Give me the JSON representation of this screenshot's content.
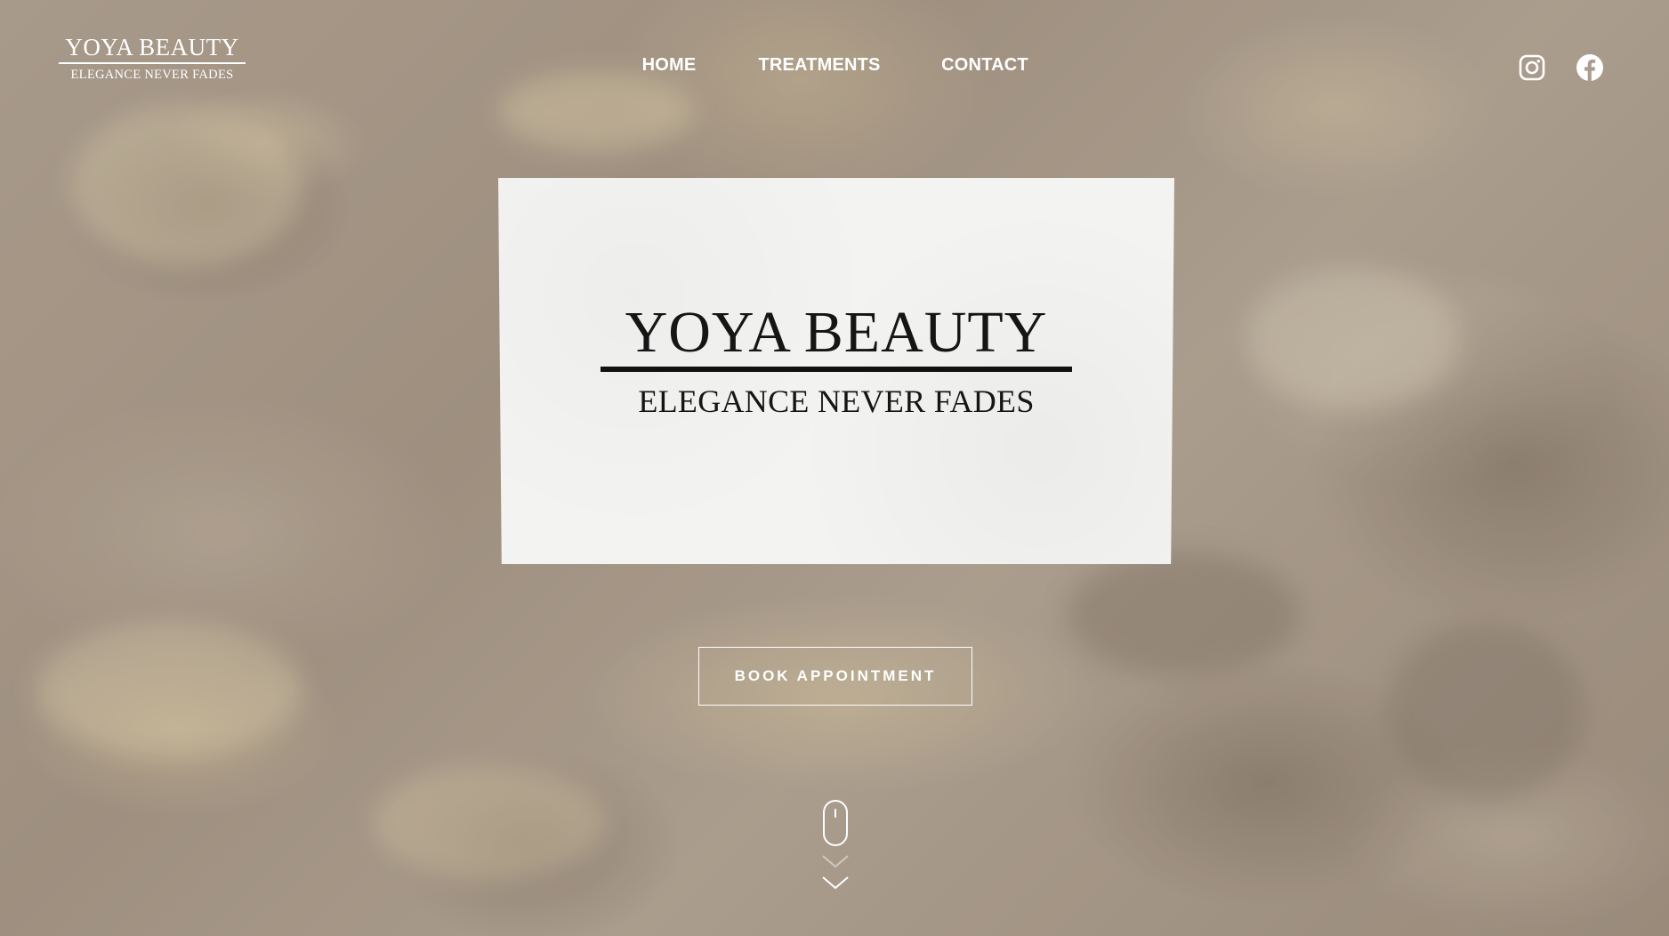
{
  "logo": {
    "title": "YOYA BEAUTY",
    "subtitle": "ELEGANCE NEVER FADES"
  },
  "nav": {
    "items": [
      {
        "label": "HOME"
      },
      {
        "label": "TREATMENTS"
      },
      {
        "label": "CONTACT"
      }
    ]
  },
  "social": {
    "icons": [
      "instagram-icon",
      "facebook-icon"
    ]
  },
  "hero_card": {
    "title": "YOYA BEAUTY",
    "subtitle": "ELEGANCE NEVER FADES"
  },
  "cta": {
    "label": "BOOK APPOINTMENT"
  },
  "scroll_indicator": {
    "icons": [
      "mouse-icon",
      "chevron-down-icon"
    ]
  },
  "colors": {
    "text_light": "#ffffff",
    "card_bg": "#f3f3f2",
    "card_text": "#151515",
    "background": "#ab9c8e"
  }
}
